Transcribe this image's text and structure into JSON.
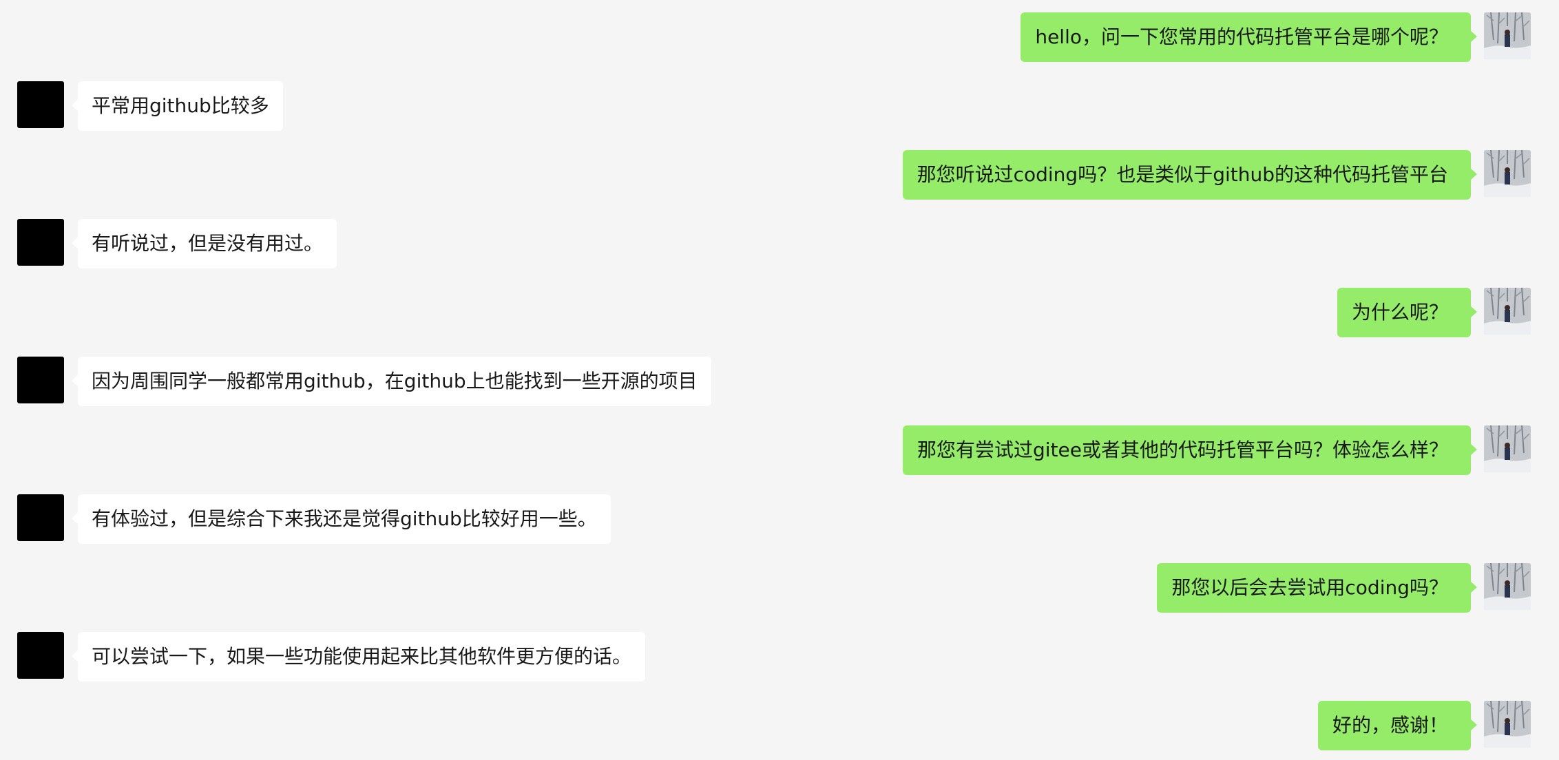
{
  "messages": [
    {
      "sender": "self",
      "avatar": "snow-tree-photo",
      "text": "hello，问一下您常用的代码托管平台是哪个呢？"
    },
    {
      "sender": "other",
      "avatar": "black-square",
      "text": "平常用github比较多"
    },
    {
      "sender": "self",
      "avatar": "snow-tree-photo",
      "text": "那您听说过coding吗？也是类似于github的这种代码托管平台"
    },
    {
      "sender": "other",
      "avatar": "black-square",
      "text": "有听说过，但是没有用过。"
    },
    {
      "sender": "self",
      "avatar": "snow-tree-photo",
      "text": "为什么呢？"
    },
    {
      "sender": "other",
      "avatar": "black-square",
      "text": "因为周围同学一般都常用github，在github上也能找到一些开源的项目"
    },
    {
      "sender": "self",
      "avatar": "snow-tree-photo",
      "text": "那您有尝试过gitee或者其他的代码托管平台吗？体验怎么样？"
    },
    {
      "sender": "other",
      "avatar": "black-square",
      "text": "有体验过，但是综合下来我还是觉得github比较好用一些。"
    },
    {
      "sender": "self",
      "avatar": "snow-tree-photo",
      "text": "那您以后会去尝试用coding吗？"
    },
    {
      "sender": "other",
      "avatar": "black-square",
      "text": "可以尝试一下，如果一些功能使用起来比其他软件更方便的话。"
    },
    {
      "sender": "self",
      "avatar": "snow-tree-photo",
      "text": "好的，感谢！"
    }
  ],
  "colors": {
    "background": "#f5f5f5",
    "self_bubble": "#95ec69",
    "other_bubble": "#ffffff",
    "text": "#191919",
    "other_avatar": "#000000"
  }
}
